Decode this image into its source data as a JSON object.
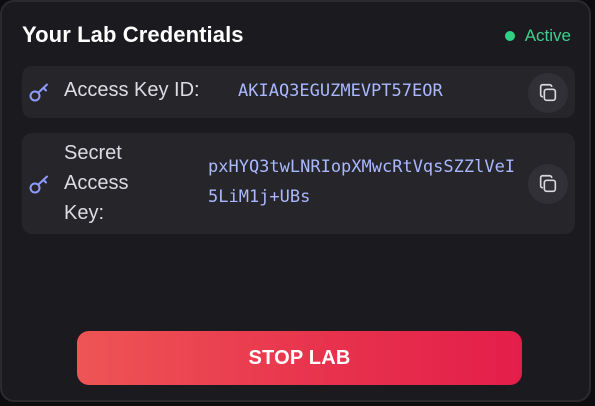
{
  "header": {
    "title": "Your Lab Credentials",
    "status_label": "Active",
    "status_color": "#2fcf86"
  },
  "credentials": [
    {
      "label": "Access Key ID:",
      "value": "AKIAQ3EGUZMEVPT57EOR",
      "icon": "key-icon",
      "copy_icon": "copy-icon"
    },
    {
      "label": "Secret Access Key:",
      "value": "pxHYQ3twLNRIopXMwcRtVqsSZZlVeI5LiM1j+UBs",
      "icon": "key-icon",
      "copy_icon": "copy-icon"
    }
  ],
  "actions": {
    "stop_label": "STOP LAB"
  },
  "colors": {
    "accent_value": "#a9b8ff",
    "stop_button_start": "#ee5555",
    "stop_button_end": "#e31e4a"
  }
}
